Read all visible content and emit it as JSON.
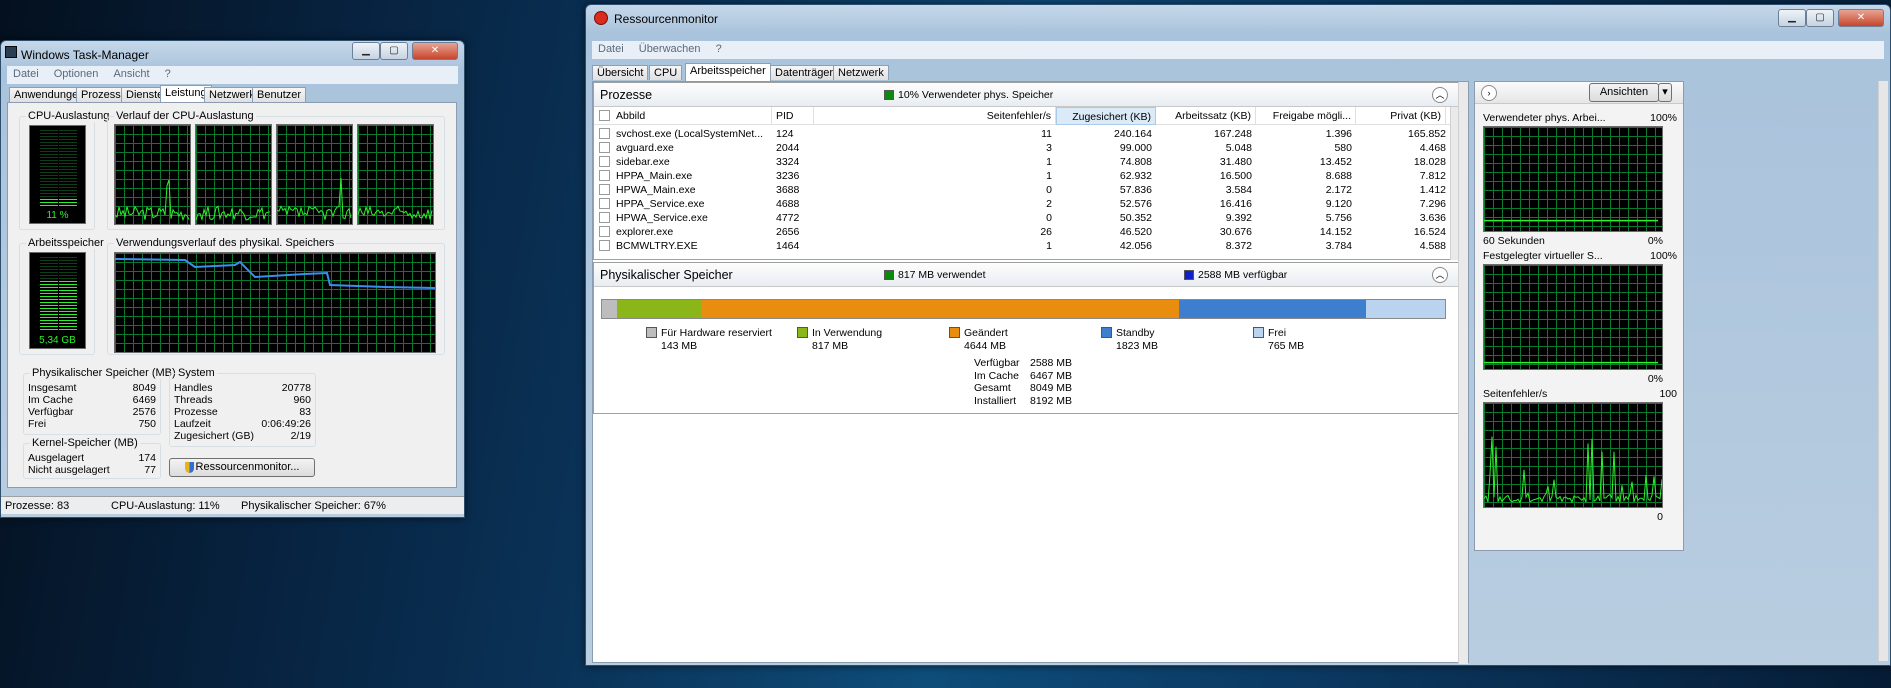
{
  "taskmgr": {
    "title": "Windows Task-Manager",
    "menu": [
      "Datei",
      "Optionen",
      "Ansicht",
      "?"
    ],
    "tabs": [
      "Anwendungen",
      "Prozesse",
      "Dienste",
      "Leistung",
      "Netzwerk",
      "Benutzer"
    ],
    "active_tab": "Leistung",
    "cpu_usage_label": "CPU-Auslastung",
    "cpu_value": "11 %",
    "cpu_percent": 11,
    "cpu_history_label": "Verlauf der CPU-Auslastung",
    "memory_label": "Arbeitsspeicher",
    "memory_value": "5,34 GB",
    "memory_fraction": 0.67,
    "memory_history_label": "Verwendungsverlauf des physikal. Speichers",
    "phys_mem": {
      "title": "Physikalischer Speicher (MB)",
      "rows": [
        {
          "k": "Insgesamt",
          "v": "8049"
        },
        {
          "k": "Im Cache",
          "v": "6469"
        },
        {
          "k": "Verfügbar",
          "v": "2576"
        },
        {
          "k": "Frei",
          "v": "750"
        }
      ]
    },
    "kernel_mem": {
      "title": "Kernel-Speicher (MB)",
      "rows": [
        {
          "k": "Ausgelagert",
          "v": "174"
        },
        {
          "k": "Nicht ausgelagert",
          "v": "77"
        }
      ]
    },
    "system": {
      "title": "System",
      "rows": [
        {
          "k": "Handles",
          "v": "20778"
        },
        {
          "k": "Threads",
          "v": "960"
        },
        {
          "k": "Prozesse",
          "v": "83"
        },
        {
          "k": "Laufzeit",
          "v": "0:06:49:26"
        },
        {
          "k": "Zugesichert (GB)",
          "v": "2/19"
        }
      ]
    },
    "resmon_button": "Ressourcenmonitor...",
    "status": {
      "processes": "Prozesse: 83",
      "cpu": "CPU-Auslastung: 11%",
      "mem": "Physikalischer Speicher: 67%"
    }
  },
  "resmon": {
    "title": "Ressourcenmonitor",
    "menu": [
      "Datei",
      "Überwachen",
      "?"
    ],
    "tabs": [
      "Übersicht",
      "CPU",
      "Arbeitsspeicher",
      "Datenträger",
      "Netzwerk"
    ],
    "active_tab": "Arbeitsspeicher",
    "processes": {
      "title": "Prozesse",
      "status": "10% Verwendeter phys. Speicher",
      "columns": [
        "Abbild",
        "PID",
        "Seitenfehler/s",
        "Zugesichert (KB)",
        "Arbeitssatz (KB)",
        "Freigabe mögli...",
        "Privat (KB)"
      ],
      "rows": [
        [
          "svchost.exe (LocalSystemNet...",
          "124",
          "11",
          "240.164",
          "167.248",
          "1.396",
          "165.852"
        ],
        [
          "avguard.exe",
          "2044",
          "3",
          "99.000",
          "5.048",
          "580",
          "4.468"
        ],
        [
          "sidebar.exe",
          "3324",
          "1",
          "74.808",
          "31.480",
          "13.452",
          "18.028"
        ],
        [
          "HPPA_Main.exe",
          "3236",
          "1",
          "62.932",
          "16.500",
          "8.688",
          "7.812"
        ],
        [
          "HPWA_Main.exe",
          "3688",
          "0",
          "57.836",
          "3.584",
          "2.172",
          "1.412"
        ],
        [
          "HPPA_Service.exe",
          "4688",
          "2",
          "52.576",
          "16.416",
          "9.120",
          "7.296"
        ],
        [
          "HPWA_Service.exe",
          "4772",
          "0",
          "50.352",
          "9.392",
          "5.756",
          "3.636"
        ],
        [
          "explorer.exe",
          "2656",
          "26",
          "46.520",
          "30.676",
          "14.152",
          "16.524"
        ],
        [
          "BCMWLTRY.EXE",
          "1464",
          "1",
          "42.056",
          "8.372",
          "3.784",
          "4.588"
        ]
      ]
    },
    "physical": {
      "title": "Physikalischer Speicher",
      "used": "817 MB verwendet",
      "available": "2588 MB verfügbar",
      "segments": [
        {
          "label": "Für Hardware reserviert",
          "value": "143 MB",
          "mb": 143,
          "color": "#bdbdbd"
        },
        {
          "label": "In Verwendung",
          "value": "817 MB",
          "mb": 817,
          "color": "#8ab61a"
        },
        {
          "label": "Geändert",
          "value": "4644 MB",
          "mb": 4644,
          "color": "#e98d0f"
        },
        {
          "label": "Standby",
          "value": "1823 MB",
          "mb": 1823,
          "color": "#3d7fce"
        },
        {
          "label": "Frei",
          "value": "765 MB",
          "mb": 765,
          "color": "#bad4f0"
        }
      ],
      "summary": [
        {
          "k": "Verfügbar",
          "v": "2588 MB"
        },
        {
          "k": "Im Cache",
          "v": "6467 MB"
        },
        {
          "k": "Gesamt",
          "v": "8049 MB"
        },
        {
          "k": "Installiert",
          "v": "8192 MB"
        }
      ]
    },
    "side": {
      "views_button": "Ansichten",
      "graph1_title": "Verwendeter phys. Arbei...",
      "graph1_max": "100%",
      "graph1_min": "0%",
      "graph1_time": "60 Sekunden",
      "graph2_title": "Festgelegter virtueller S...",
      "graph2_max": "100%",
      "graph2_min": "0%",
      "graph3_title": "Seitenfehler/s",
      "graph3_max": "100",
      "graph3_min": "0"
    }
  },
  "colors": {
    "graph_green": "#2cf22c",
    "graph_grid": "#0a7a2e",
    "mem_line": "#3a8ef0"
  }
}
